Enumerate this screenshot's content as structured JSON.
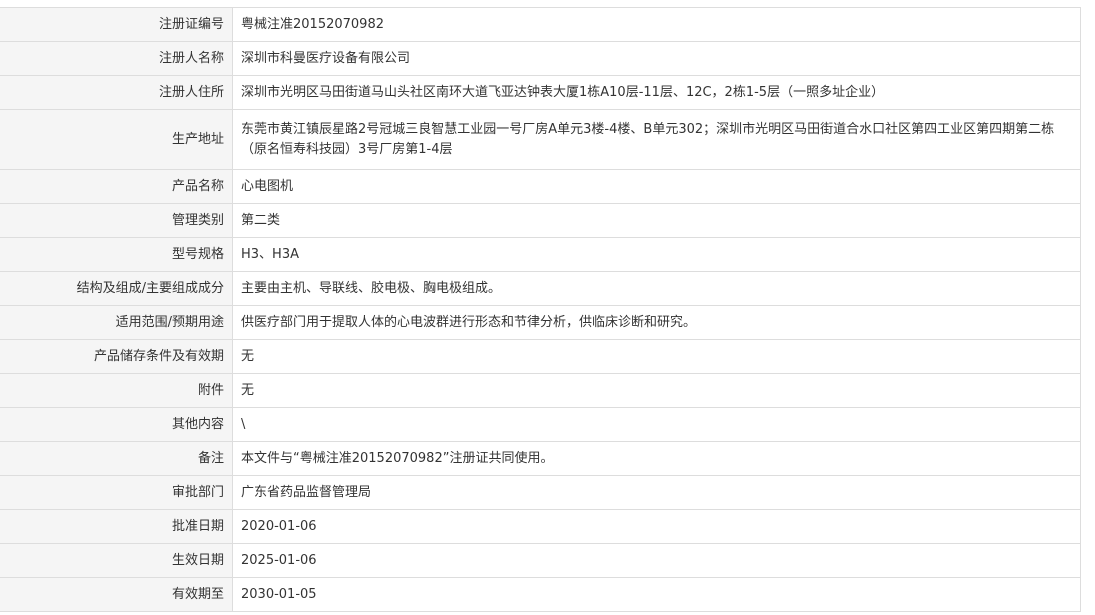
{
  "rows": [
    {
      "label": "注册证编号",
      "value": "粤械注准20152070982"
    },
    {
      "label": "注册人名称",
      "value": "深圳市科曼医疗设备有限公司"
    },
    {
      "label": "注册人住所",
      "value": "深圳市光明区马田街道马山头社区南环大道飞亚达钟表大厦1栋A10层-11层、12C，2栋1-5层（一照多址企业）"
    },
    {
      "label": "生产地址",
      "value": "东莞市黄江镇辰星路2号冠城三良智慧工业园一号厂房A单元3楼-4楼、B单元302；深圳市光明区马田街道合水口社区第四工业区第四期第二栋（原名恒寿科技园）3号厂房第1-4层"
    },
    {
      "label": "产品名称",
      "value": "心电图机"
    },
    {
      "label": "管理类别",
      "value": "第二类"
    },
    {
      "label": "型号规格",
      "value": "H3、H3A"
    },
    {
      "label": "结构及组成/主要组成成分",
      "value": "主要由主机、导联线、胶电极、胸电极组成。"
    },
    {
      "label": "适用范围/预期用途",
      "value": "供医疗部门用于提取人体的心电波群进行形态和节律分析，供临床诊断和研究。"
    },
    {
      "label": "产品储存条件及有效期",
      "value": "无"
    },
    {
      "label": "附件",
      "value": "无"
    },
    {
      "label": "其他内容",
      "value": "\\"
    },
    {
      "label": "备注",
      "value": "本文件与“粤械注准20152070982”注册证共同使用。"
    },
    {
      "label": "审批部门",
      "value": "广东省药品监督管理局"
    },
    {
      "label": "批准日期",
      "value": "2020-01-06"
    },
    {
      "label": "生效日期",
      "value": "2025-01-06"
    },
    {
      "label": "有效期至",
      "value": "2030-01-05"
    }
  ]
}
